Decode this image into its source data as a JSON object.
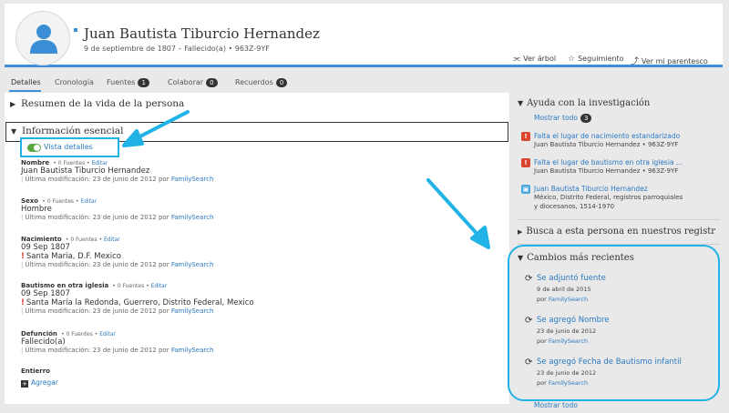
{
  "person": {
    "name": "Juan Bautista Tiburcio Hernandez",
    "subtitle": "9 de septiembre de 1807 – Fallecido(a)  •  963Z-9YF"
  },
  "header_actions": {
    "tree": "Ver árbol",
    "follow": "Seguimiento",
    "relationship": "Ver mi parentesco"
  },
  "tabs": [
    {
      "label": "Detalles"
    },
    {
      "label": "Cronología"
    },
    {
      "label": "Fuentes",
      "badge": "1"
    },
    {
      "label": "Colaborar",
      "badge": "0"
    },
    {
      "label": "Recuerdos",
      "badge": "0"
    }
  ],
  "main": {
    "summary_title": "Resumen de la vida de la persona",
    "essential_title": "Información esencial",
    "toggle_label": "Vista detalles",
    "facts": [
      {
        "label": "Nombre",
        "sources": "0 Fuentes",
        "edit": "Editar",
        "value": "Juan Bautista Tiburcio Hernandez",
        "place": "",
        "modified": "Última modificación: 23 de junio de 2012 por",
        "by": "FamilySearch"
      },
      {
        "label": "Sexo",
        "sources": "0 Fuentes",
        "edit": "Editar",
        "value": "Hombre",
        "place": "",
        "modified": "Última modificación: 23 de junio de 2012 por",
        "by": "FamilySearch"
      },
      {
        "label": "Nacimiento",
        "sources": "0 Fuentes",
        "edit": "Editar",
        "value": "09 Sep 1807",
        "place": "Santa Maria, D.F. Mexico",
        "modified": "Última modificación: 23 de junio de 2012 por",
        "by": "FamilySearch"
      },
      {
        "label": "Bautismo en otra iglesia",
        "sources": "0 Fuentes",
        "edit": "Editar",
        "value": "09 Sep 1807",
        "place": "Santa María la Redonda, Guerrero, Distrito Federal, Mexico",
        "modified": "Última modificación: 23 de junio de 2012 por",
        "by": "FamilySearch"
      },
      {
        "label": "Defunción",
        "sources": "0 Fuentes",
        "edit": "Editar",
        "value": "Fallecido(a)",
        "place": "",
        "modified": "Última modificación: 23 de junio de 2012 por",
        "by": "FamilySearch"
      }
    ],
    "burial_label": "Entierro",
    "add_label": "Agregar"
  },
  "sidebar": {
    "research_title": "Ayuda con la investigación",
    "show_all": "Mostrar todo",
    "show_all_count": "3",
    "tasks": [
      {
        "kind": "warning",
        "title": "Falta el lugar de nacimiento estandarizado",
        "lines": [
          "Juan Bautista Tiburcio Hernandez  •  963Z-9YF"
        ]
      },
      {
        "kind": "warning",
        "title": "Falta el lugar de bautismo en otra iglesia ...",
        "lines": [
          "Juan Bautista Tiburcio Hernandez  •  963Z-9YF"
        ]
      },
      {
        "kind": "record",
        "title": "Juan Bautista Tiburcio Hernandez",
        "lines": [
          "México, Distrito Federal, registros parroquiales",
          "y diocesanos, 1514-1970"
        ]
      }
    ],
    "search_title": "Busca a esta persona en nuestros registr",
    "changes_title": "Cambios más recientes",
    "changes": [
      {
        "title": "Se adjuntó fuente",
        "date": "9 de abril de 2015",
        "by_prefix": "por",
        "by": "FamilySearch"
      },
      {
        "title": "Se agregó Nombre",
        "date": "23 de junio de 2012",
        "by_prefix": "por",
        "by": "FamilySearch"
      },
      {
        "title": "Se agregó Fecha de Bautismo infantil",
        "date": "23 de junio de 2012",
        "by_prefix": "por",
        "by": "FamilySearch"
      }
    ],
    "changes_show_all": "Mostrar todo"
  },
  "colors": {
    "accent_blue": "#3a8fd6",
    "link_blue": "#2b79c2",
    "highlight_cyan": "#21b3e6",
    "toggle_green": "#5ba843",
    "warning_red": "#d9452e"
  }
}
